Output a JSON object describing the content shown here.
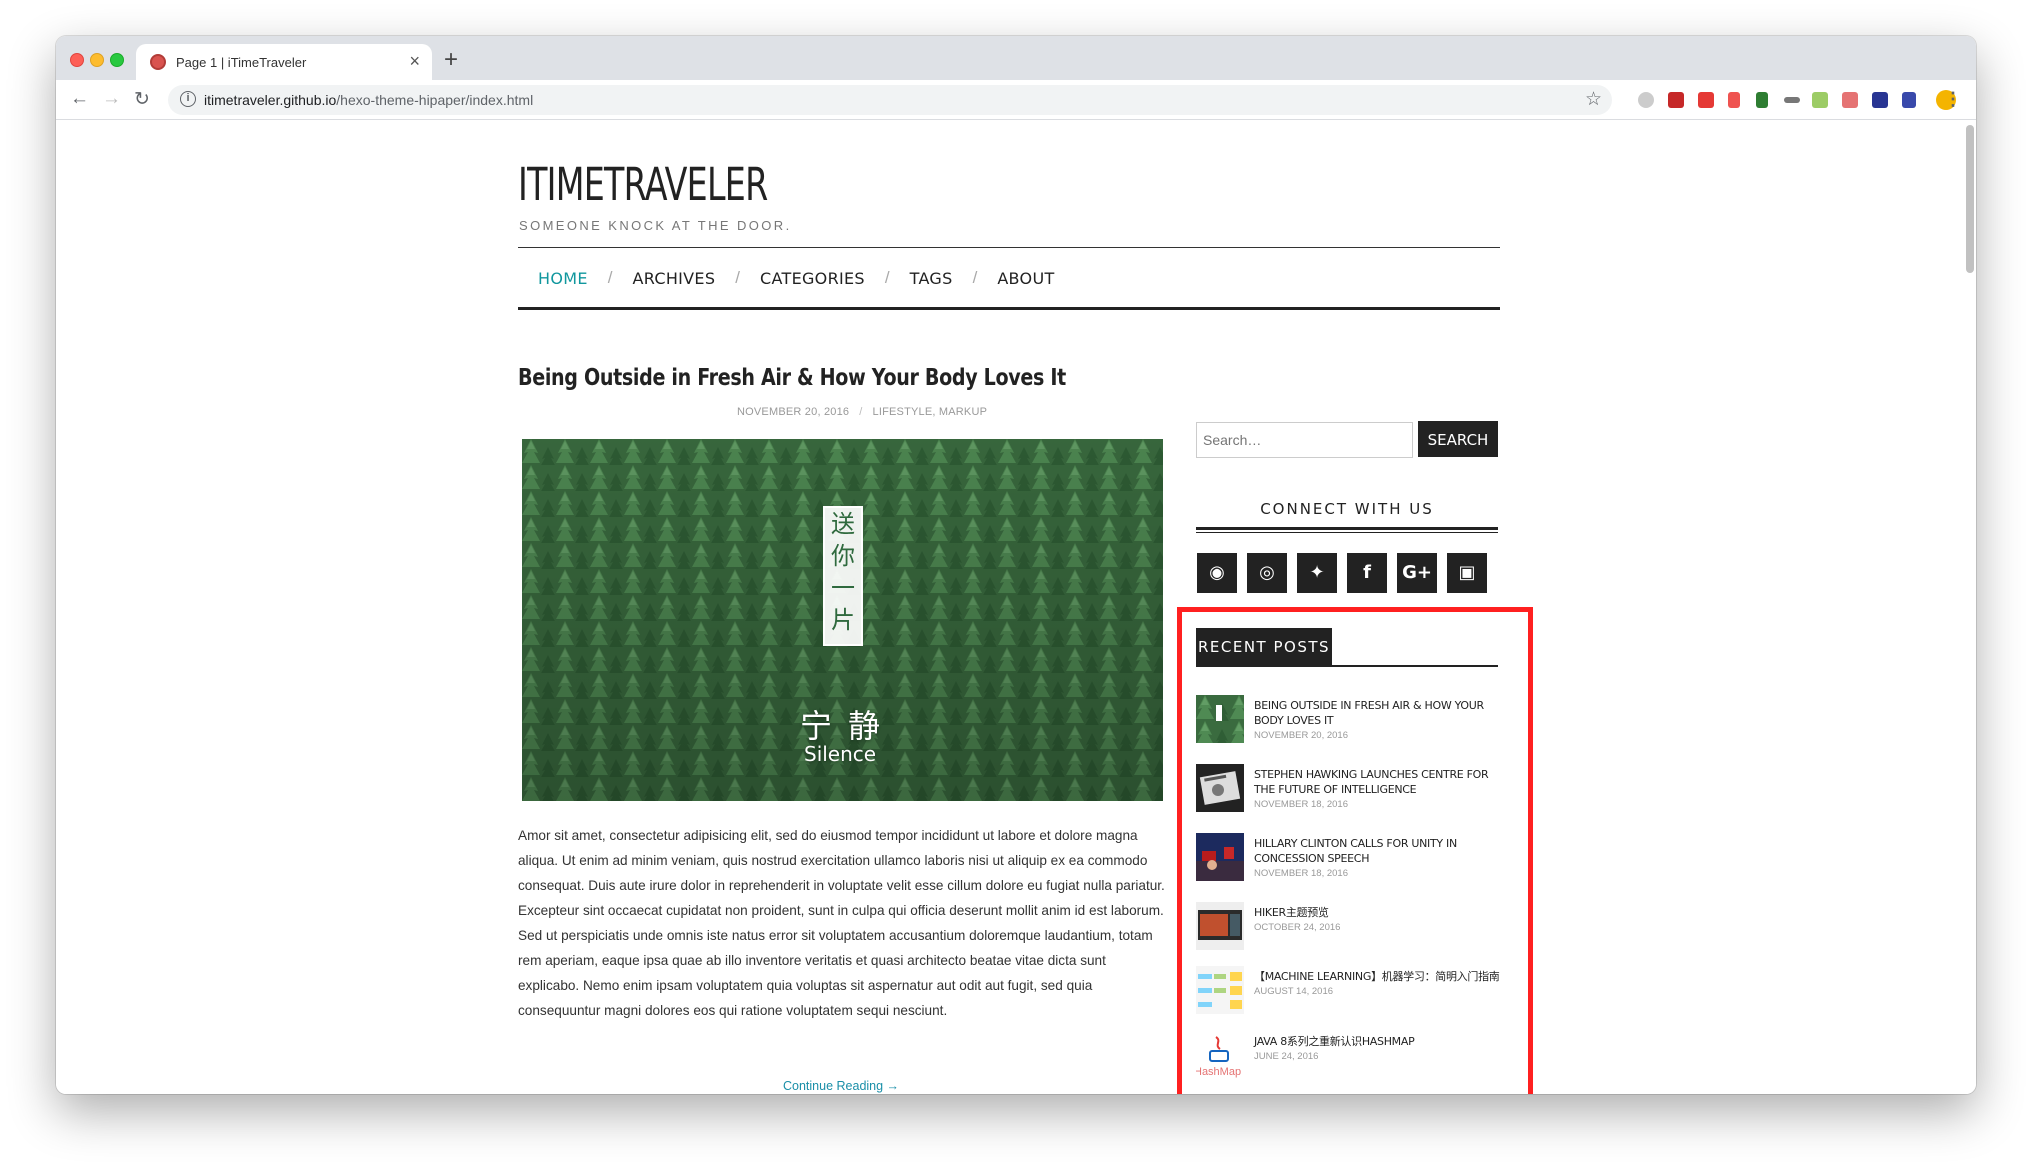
{
  "browser": {
    "tab_title": "Page 1 | iTimeTraveler",
    "tab_close": "×",
    "new_tab": "+",
    "url_host": "itimetraveler.github.io",
    "url_path": "/hexo-theme-hipaper/index.html",
    "back": "←",
    "forward": "→",
    "reload": "↻",
    "info": "i",
    "star": "☆",
    "menu": "⋮"
  },
  "site": {
    "title": "ITIMETRAVELER",
    "tagline": "SOMEONE KNOCK AT THE DOOR.",
    "nav": [
      {
        "label": "HOME",
        "active": true
      },
      {
        "label": "ARCHIVES"
      },
      {
        "label": "CATEGORIES"
      },
      {
        "label": "TAGS"
      },
      {
        "label": "ABOUT"
      }
    ],
    "nav_separator": "/",
    "accent_color": "#11979e"
  },
  "post": {
    "title": "Being Outside in Fresh Air & How Your Body Loves It",
    "date": "NOVEMBER 20, 2016",
    "meta_separator": "/",
    "categories": "LIFESTYLE, MARKUP",
    "hero_badge": [
      "送",
      "你",
      "一",
      "片"
    ],
    "hero_cn": "宁静",
    "hero_en": "Silence",
    "excerpt": "Amor sit amet, consectetur adipisicing elit, sed do eiusmod tempor incididunt ut labore et dolore magna aliqua. Ut enim ad minim veniam, quis nostrud exercitation ullamco laboris nisi ut aliquip ex ea commodo consequat. Duis aute irure dolor in reprehenderit in voluptate velit esse cillum dolore eu fugiat nulla pariatur. Excepteur sint occaecat cupidatat non proident, sunt in culpa qui officia deserunt mollit anim id est laborum. Sed ut perspiciatis unde omnis iste natus error sit voluptatem accusantium doloremque laudantium, totam rem aperiam, eaque ipsa quae ab illo inventore veritatis et quasi architecto beatae vitae dicta sunt explicabo. Nemo enim ipsam voluptatem quia voluptas sit aspernatur aut odit aut fugit, sed quia consequuntur magni dolores eos qui ratione voluptatem sequi nesciunt.",
    "continue": "Continue Reading →"
  },
  "sidebar": {
    "search_placeholder": "Search…",
    "search_button": "SEARCH",
    "connect_title": "CONNECT WITH US",
    "social": [
      {
        "name": "github-icon",
        "glyph": "◉"
      },
      {
        "name": "weibo-icon",
        "glyph": "◎"
      },
      {
        "name": "twitter-icon",
        "glyph": "✦"
      },
      {
        "name": "facebook-icon",
        "glyph": "f"
      },
      {
        "name": "google-plus-icon",
        "glyph": "G+"
      },
      {
        "name": "instagram-icon",
        "glyph": "▣"
      }
    ],
    "recent_title": "RECENT POSTS",
    "recent_posts": [
      {
        "title": "Being Outside in Fresh Air & How Your Body Loves It",
        "date": "NOVEMBER 20, 2016"
      },
      {
        "title": "Stephen Hawking Launches Centre for the Future of Intelligence",
        "date": "NOVEMBER 18, 2016"
      },
      {
        "title": "Hillary Clinton calls for unity in concession speech",
        "date": "NOVEMBER 18, 2016"
      },
      {
        "title": "Hiker主题预览",
        "date": "OCTOBER 24, 2016"
      },
      {
        "title": "【Machine Learning】机器学习：简明入门指南",
        "date": "AUGUST 14, 2016"
      },
      {
        "title": "Java 8系列之重新认识HashMap",
        "date": "JUNE 24, 2016"
      }
    ],
    "thumb_hashmap_text": "HashMap"
  }
}
